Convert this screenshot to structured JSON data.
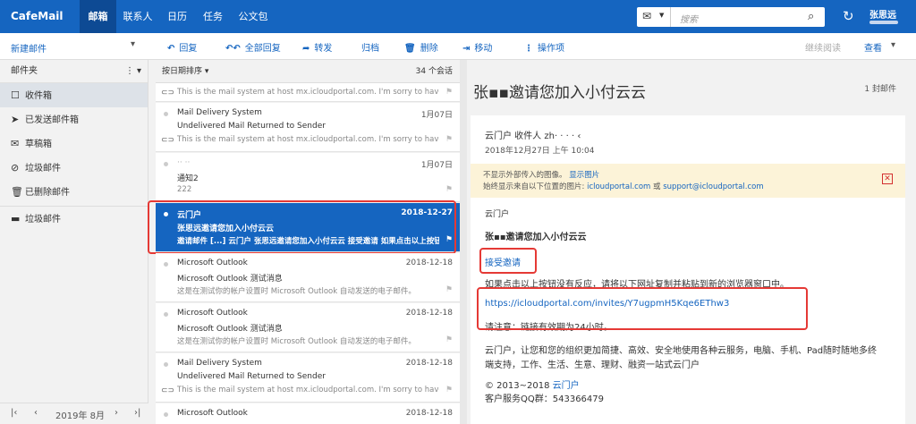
{
  "topbar": {
    "logo": "CafeMail",
    "tabs": [
      "邮箱",
      "联系人",
      "日历",
      "任务",
      "公文包"
    ],
    "search_placeholder": "搜索",
    "user": "张思远"
  },
  "toolbar": {
    "new_mail": "新建邮件",
    "reply": "回复",
    "reply_all": "全部回复",
    "forward": "转发",
    "archive": "归档",
    "delete": "删除",
    "move": "移动",
    "actions": "操作项",
    "continue_reading": "继续阅读",
    "view": "查看"
  },
  "sidebar": {
    "header": "邮件夹",
    "folders": [
      "收件箱",
      "已发送邮件箱",
      "草稿箱",
      "垃圾邮件",
      "已删除邮件",
      "垃圾邮件"
    ],
    "footer_month": "2019年 8月"
  },
  "list": {
    "sort": "按日期排序",
    "count": "34 个会话",
    "items": [
      {
        "from": "",
        "date": "",
        "subject": "",
        "preview": "This is the mail system at host mx.icloudportal.com. I'm sorry to have to inform"
      },
      {
        "from": "Mail Delivery System",
        "date": "1月07日",
        "subject": "Undelivered Mail Returned to Sender",
        "preview": "This is the mail system at host mx.icloudportal.com. I'm sorry to have to inform"
      },
      {
        "from": "·· ··",
        "date": "1月07日",
        "subject": "通知2",
        "preview": "222"
      },
      {
        "from": "云门户",
        "date": "2018-12-27",
        "subject": "张思远邀请您加入小付云云",
        "preview": "邀请邮件 [...] 云门户 张思远邀请您加入小付云云 接受邀请 如果点击以上按钮没"
      },
      {
        "from": "Microsoft Outlook",
        "date": "2018-12-18",
        "subject": "Microsoft Outlook 测试消息",
        "preview": "这是在测试你的帐户设置时 Microsoft Outlook 自动发送的电子邮件。"
      },
      {
        "from": "Microsoft Outlook",
        "date": "2018-12-18",
        "subject": "Microsoft Outlook 测试消息",
        "preview": "这是在测试你的帐户设置时 Microsoft Outlook 自动发送的电子邮件。"
      },
      {
        "from": "Mail Delivery System",
        "date": "2018-12-18",
        "subject": "Undelivered Mail Returned to Sender",
        "preview": "This is the mail system at host mx.icloudportal.com. I'm sorry to have to inform"
      },
      {
        "from": "Microsoft Outlook",
        "date": "2018-12-18",
        "subject": "",
        "preview": ""
      }
    ]
  },
  "reading": {
    "title": "张▪▪邀请您加入小付云云",
    "count": "1 封邮件",
    "sender": "云门户  收件人 zh·  ·  ·  ·  ‹",
    "date": "2018年12月27日 上午 10:04",
    "banner_line1": "不显示外部传入的图像。",
    "banner_show": "显示图片",
    "banner_line2": "始终显示来自以下位置的图片:",
    "banner_domain1": "icloudportal.com",
    "banner_or": "或",
    "banner_domain2": "support@icloudportal.com",
    "body_from": "云门户",
    "body_heading": "张▪▪邀请您加入小付云云",
    "accept": "接受邀请",
    "instruction": "如果点击以上按钮没有反应，请将以下网址复制并粘贴到新的浏览器窗口中。",
    "url": "https://icloudportal.com/invites/Y7ugpmH5Kqe6EThw3",
    "validity": "请注意：链接有效期为24小时。",
    "about1": "云门户，让您和您的组织更加简捷、高效、安全地使用各种云服务，电脑、手机、Pad随时随地多终",
    "about2": "端支持，工作、生活、生意、理财、融资一站式云门户",
    "copyright": "© 2013~2018",
    "copyright_link": "云门户",
    "qq": "客户服务QQ群：543366479"
  }
}
